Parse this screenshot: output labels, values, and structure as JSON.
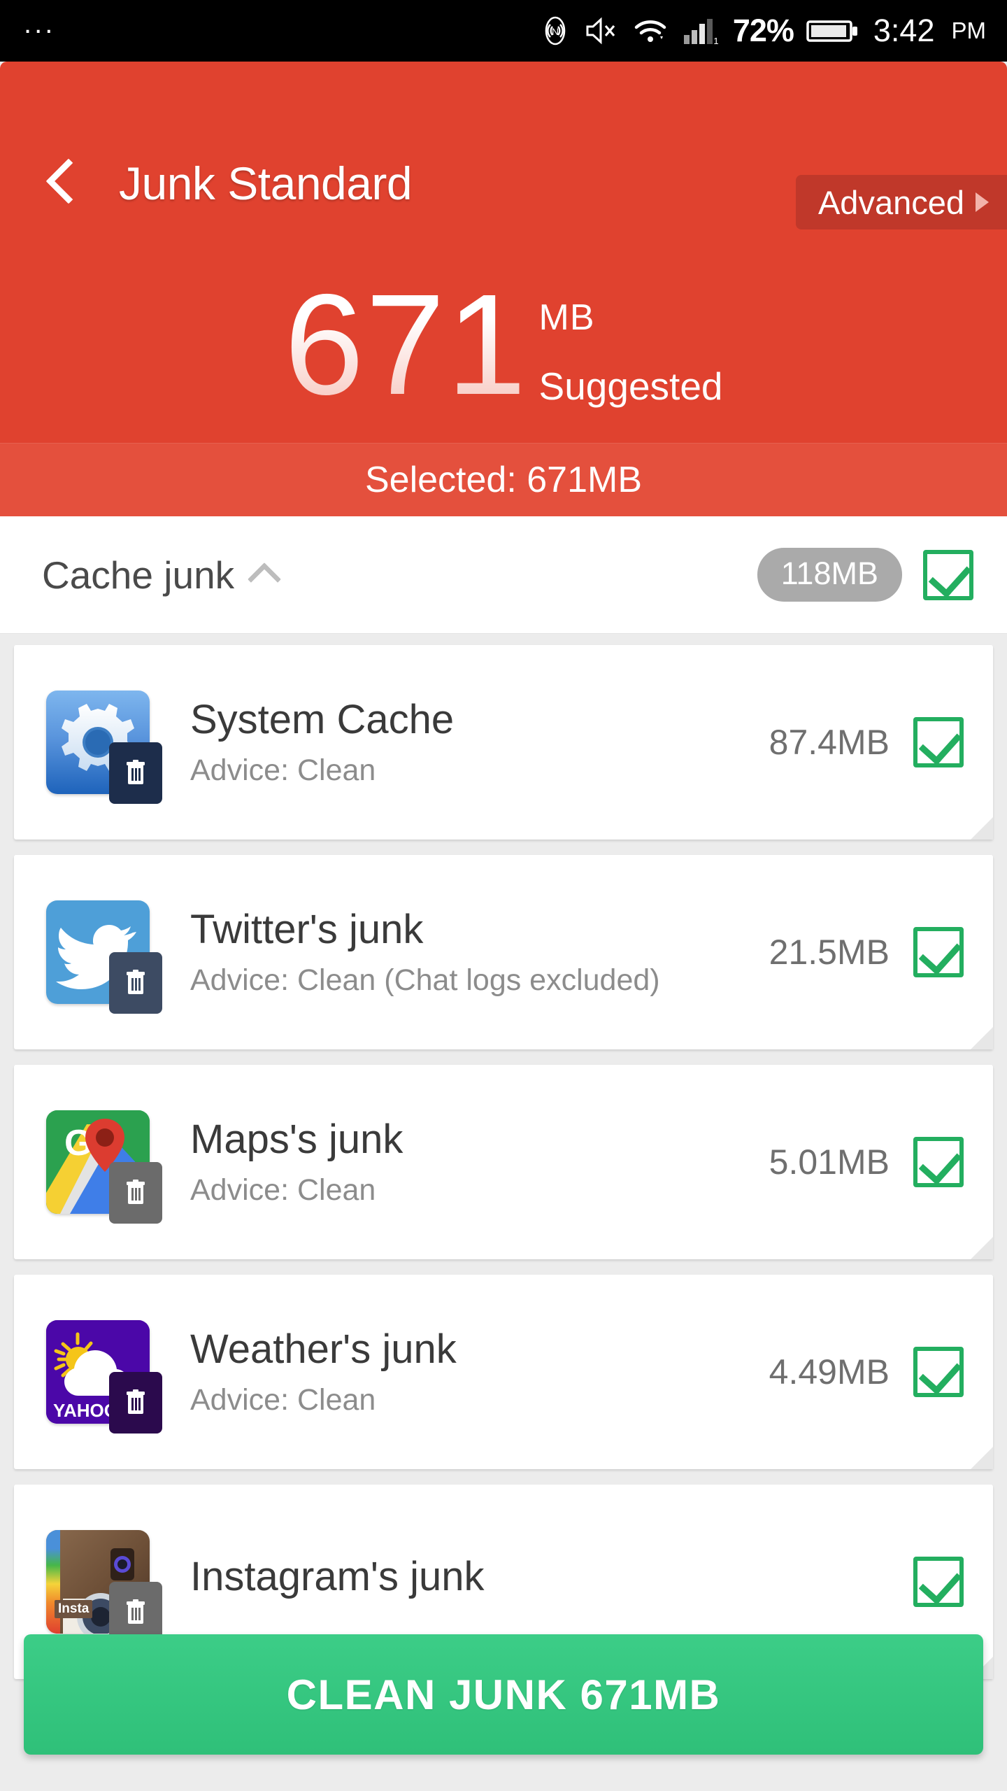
{
  "statusbar": {
    "overflow": "...",
    "battery_percent": "72%",
    "time": "3:42",
    "ampm": "PM",
    "signal_label": "1",
    "icons": [
      "nfc-icon",
      "volume-muted-icon",
      "wifi-icon",
      "signal-bars-icon",
      "battery-icon"
    ]
  },
  "header": {
    "title": "Junk Standard",
    "back_icon": "back-chevron-icon",
    "advanced_label": "Advanced",
    "advanced_arrow_icon": "chevron-right-icon",
    "total_value": "671",
    "total_unit": "MB",
    "total_caption": "Suggested",
    "selected_text": "Selected: 671MB",
    "bg_color": "#e0422f",
    "advanced_bg_color": "#c0382a",
    "band_color": "#e4503d"
  },
  "group": {
    "title": "Cache junk",
    "collapse_icon": "chevron-up-icon",
    "size": "118MB",
    "checked": true,
    "pill_color": "#aaaaaa",
    "check_color": "#23ae5f"
  },
  "items": [
    {
      "name": "System Cache",
      "advice": "Advice: Clean",
      "size": "87.4MB",
      "checked": true,
      "icon": "system-cache-gear-icon"
    },
    {
      "name": "Twitter's junk",
      "advice": "Advice: Clean (Chat logs excluded)",
      "size": "21.5MB",
      "checked": true,
      "icon": "twitter-icon"
    },
    {
      "name": "Maps's junk",
      "advice": "Advice: Clean",
      "size": "5.01MB",
      "checked": true,
      "icon": "google-maps-icon"
    },
    {
      "name": "Weather's junk",
      "advice": "Advice: Clean",
      "size": "4.49MB",
      "checked": true,
      "icon": "yahoo-weather-icon",
      "icon_wordmark": "YAHOO"
    },
    {
      "name": "Instagram's junk",
      "advice": "",
      "size": "",
      "checked": true,
      "icon": "instagram-icon",
      "icon_wordmark": "Insta"
    }
  ],
  "footer": {
    "clean_label": "CLEAN JUNK 671MB",
    "button_color": "#2fc079"
  }
}
